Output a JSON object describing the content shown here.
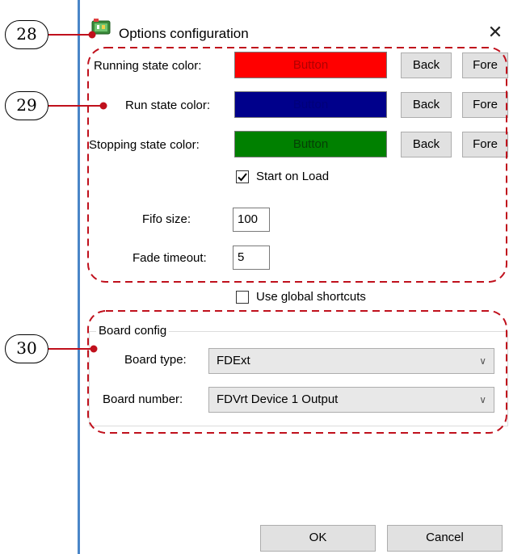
{
  "window": {
    "title": "Options configuration",
    "close_glyph": "✕"
  },
  "colors": {
    "running": "#ff0000",
    "run": "#00008b",
    "stopping": "#008000",
    "callout": "#c0101c",
    "window_border": "#4a86c8"
  },
  "state_rows": [
    {
      "label": "Running state color:",
      "button": "Button",
      "back": "Back",
      "fore": "Fore"
    },
    {
      "label": "Run state color:",
      "button": "Button",
      "back": "Back",
      "fore": "Fore"
    },
    {
      "label": "Stopping state color:",
      "button": "Button",
      "back": "Back",
      "fore": "Fore"
    }
  ],
  "start_on_load": {
    "label": "Start on Load",
    "checked": true
  },
  "fifo": {
    "label": "Fifo size:",
    "value": "100"
  },
  "fade": {
    "label": "Fade timeout:",
    "value": "5"
  },
  "global_shortcuts": {
    "label": "Use global shortcuts",
    "checked": false
  },
  "board": {
    "caption": "Board config",
    "type_label": "Board type:",
    "type_value": "FDExt",
    "number_label": "Board number:",
    "number_value": "FDVrt Device 1 Output"
  },
  "footer": {
    "ok": "OK",
    "cancel": "Cancel"
  },
  "callouts": {
    "c28": "28",
    "c29": "29",
    "c30": "30"
  },
  "icons": {
    "app": "app-window-icon",
    "close": "close-icon",
    "check": "checkmark-icon",
    "dropdown": "chevron-down-icon"
  }
}
